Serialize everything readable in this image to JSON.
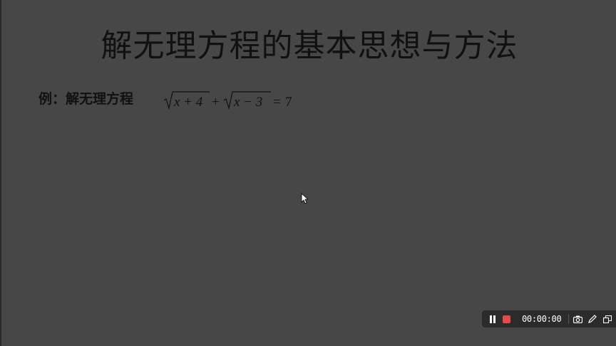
{
  "slide": {
    "title": "解无理方程的基本思想与方法",
    "example_label": "例：解无理方程",
    "equation": {
      "term1_radicand": "x + 4",
      "plus": "+",
      "term2_radicand": "x − 3",
      "equals": "=",
      "rhs": "7"
    }
  },
  "recorder": {
    "timer": "00:00:00",
    "icons": [
      "pause-icon",
      "stop-icon",
      "camera-icon",
      "pen-icon",
      "window-icon"
    ],
    "colors": {
      "bar_bg": "#2b2b2b",
      "stop": "#e84a4a",
      "text": "#ffffff"
    }
  },
  "colors": {
    "background": "#474747",
    "text": "#111111"
  }
}
